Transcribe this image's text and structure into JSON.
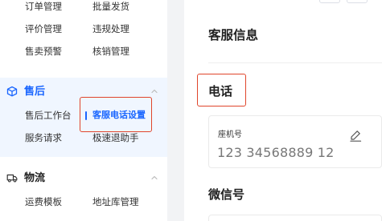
{
  "sidebar": {
    "top_rows": [
      [
        "订单管理",
        "批量发货"
      ],
      [
        "评价管理",
        "违规处理"
      ],
      [
        "售卖预警",
        "核销管理"
      ]
    ],
    "after_sales": {
      "title": "售后",
      "icon": "box-icon",
      "items": [
        "售后工作台",
        "客服电话设置",
        "服务请求",
        "极速退助手"
      ],
      "active_item": "客服电话设置"
    },
    "logistics": {
      "title": "物流",
      "icon": "truck-icon",
      "items": [
        "运费模板",
        "地址库管理"
      ]
    }
  },
  "main": {
    "panel_title": "客服信息",
    "phone_section_title": "电话",
    "phone_card": {
      "label": "座机号",
      "value": "123 34568889 12",
      "edit_icon": "pencil-icon"
    },
    "wechat_section_title": "微信号"
  },
  "colors": {
    "accent": "#1a66ff",
    "highlight": "#e0452b",
    "active_group_bg": "#f0f6ff"
  }
}
